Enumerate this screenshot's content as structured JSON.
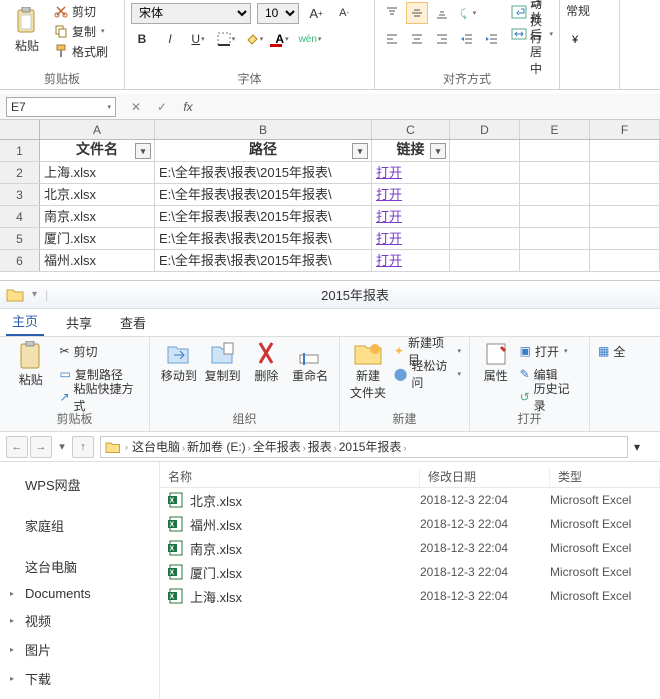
{
  "excel": {
    "ribbon": {
      "clipboard": {
        "label": "剪贴板",
        "paste": "粘贴",
        "cut": "剪切",
        "copy": "复制",
        "format_painter": "格式刷"
      },
      "font": {
        "label": "字体",
        "family": "宋体",
        "size": "10",
        "wen": "wén"
      },
      "align": {
        "label": "对齐方式",
        "wrap": "自动换行",
        "merge": "合并后居中"
      },
      "style": {
        "normal": "常规"
      }
    },
    "namebox": "E7",
    "headers": {
      "c1": "文件名",
      "c2": "路径",
      "c3": "链接"
    },
    "rows": [
      {
        "name": "上海.xlsx",
        "path": "E:\\全年报表\\报表\\2015年报表\\",
        "link": "打开"
      },
      {
        "name": "北京.xlsx",
        "path": "E:\\全年报表\\报表\\2015年报表\\",
        "link": "打开"
      },
      {
        "name": "南京.xlsx",
        "path": "E:\\全年报表\\报表\\2015年报表\\",
        "link": "打开"
      },
      {
        "name": "厦门.xlsx",
        "path": "E:\\全年报表\\报表\\2015年报表\\",
        "link": "打开"
      },
      {
        "name": "福州.xlsx",
        "path": "E:\\全年报表\\报表\\2015年报表\\",
        "link": "打开"
      }
    ]
  },
  "explorer": {
    "title": "2015年报表",
    "tabs": {
      "home": "主页",
      "share": "共享",
      "view": "查看"
    },
    "ribbon": {
      "clipboard": {
        "label": "剪贴板",
        "paste": "粘贴",
        "cut": "剪切",
        "copy_path": "复制路径",
        "paste_shortcut": "粘贴快捷方式"
      },
      "organize": {
        "label": "组织",
        "move": "移动到",
        "copy": "复制到",
        "delete": "删除",
        "rename": "重命名"
      },
      "new": {
        "label": "新建",
        "new_folder": "新建\n文件夹",
        "new_item": "新建项目",
        "easy_access": "轻松访问"
      },
      "open": {
        "label": "打开",
        "properties": "属性",
        "open": "打开",
        "edit": "编辑",
        "history": "历史记录"
      },
      "select": {
        "all": "全"
      }
    },
    "crumbs": [
      "这台电脑",
      "新加卷 (E:)",
      "全年报表",
      "报表",
      "2015年报表"
    ],
    "nav": {
      "wps": "WPS网盘",
      "homegroup": "家庭组",
      "thispc": "这台电脑",
      "documents": "Documents",
      "videos": "视频",
      "pictures": "图片",
      "downloads": "下载"
    },
    "list_headers": {
      "name": "名称",
      "date": "修改日期",
      "type": "类型"
    },
    "files": [
      {
        "name": "北京.xlsx",
        "date": "2018-12-3 22:04",
        "type": "Microsoft Excel"
      },
      {
        "name": "福州.xlsx",
        "date": "2018-12-3 22:04",
        "type": "Microsoft Excel"
      },
      {
        "name": "南京.xlsx",
        "date": "2018-12-3 22:04",
        "type": "Microsoft Excel"
      },
      {
        "name": "厦门.xlsx",
        "date": "2018-12-3 22:04",
        "type": "Microsoft Excel"
      },
      {
        "name": "上海.xlsx",
        "date": "2018-12-3 22:04",
        "type": "Microsoft Excel"
      }
    ]
  }
}
